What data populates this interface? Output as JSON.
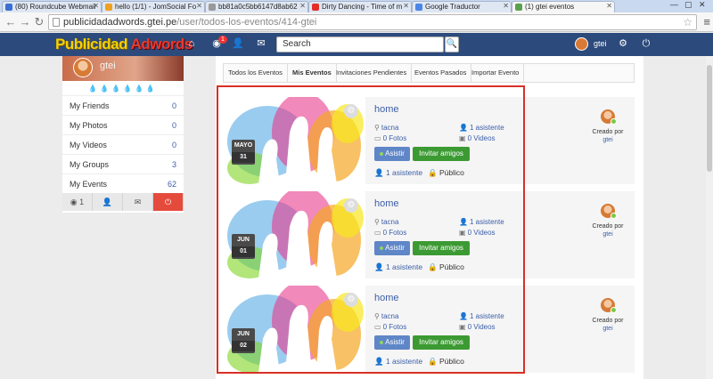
{
  "browser": {
    "tabs": [
      {
        "label": "(80) Roundcube Webmail",
        "color": "#3b6fd0"
      },
      {
        "label": "hello (1/1) - JomSocial Fo",
        "color": "#f0a020"
      },
      {
        "label": "bb81a0c5bb6147d8ab62",
        "color": "#888888"
      },
      {
        "label": "Dirty Dancing - Time of m",
        "color": "#e52d27"
      },
      {
        "label": "Google Traductor",
        "color": "#4a86e8"
      },
      {
        "label": "(1) gtei eventos",
        "color": "#5aa14f"
      }
    ],
    "url_host": "publicidadadwords.gtei.pe",
    "url_path": "/user/todos-los-eventos/414-gtei"
  },
  "site": {
    "logo_part1": "Publicidad",
    "logo_part2": "Adwords",
    "notif_count": "1",
    "search_placeholder": "Search",
    "user_name": "gtei"
  },
  "sidebar": {
    "user_name": "gtei",
    "rating": "💧💧💧💧💧💧",
    "stats": [
      {
        "label": "My Friends",
        "value": "0"
      },
      {
        "label": "My Photos",
        "value": "0"
      },
      {
        "label": "My Videos",
        "value": "0"
      },
      {
        "label": "My Groups",
        "value": "3"
      },
      {
        "label": "My Events",
        "value": "62"
      }
    ],
    "globe_count": "1"
  },
  "event_tabs": [
    "Todos los Eventos",
    "Mis Eventos",
    "Invitaciones Pendientes",
    "Eventos Pasados",
    "Importar Evento"
  ],
  "events": [
    {
      "month": "MAYO",
      "day": "31",
      "title": "home",
      "location": "tacna",
      "attendees": "1 asistente",
      "photos": "0 Fotos",
      "videos": "0 Videos",
      "attend_label": "Asistir",
      "invite_label": "Invitar amigos",
      "foot_attendees": "1 asistente",
      "privacy": "Público",
      "created_by": "Creado por",
      "creator": "gtei"
    },
    {
      "month": "JUN",
      "day": "01",
      "title": "home",
      "location": "tacna",
      "attendees": "1 asistente",
      "photos": "0 Fotos",
      "videos": "0 Videos",
      "attend_label": "Asistir",
      "invite_label": "Invitar amigos",
      "foot_attendees": "1 asistente",
      "privacy": "Público",
      "created_by": "Creado por",
      "creator": "gtei"
    },
    {
      "month": "JUN",
      "day": "02",
      "title": "home",
      "location": "tacna",
      "attendees": "1 asistente",
      "photos": "0 Fotos",
      "videos": "0 Videos",
      "attend_label": "Asistir",
      "invite_label": "Invitar amigos",
      "foot_attendees": "1 asistente",
      "privacy": "Público",
      "created_by": "Creado por",
      "creator": "gtei"
    }
  ]
}
